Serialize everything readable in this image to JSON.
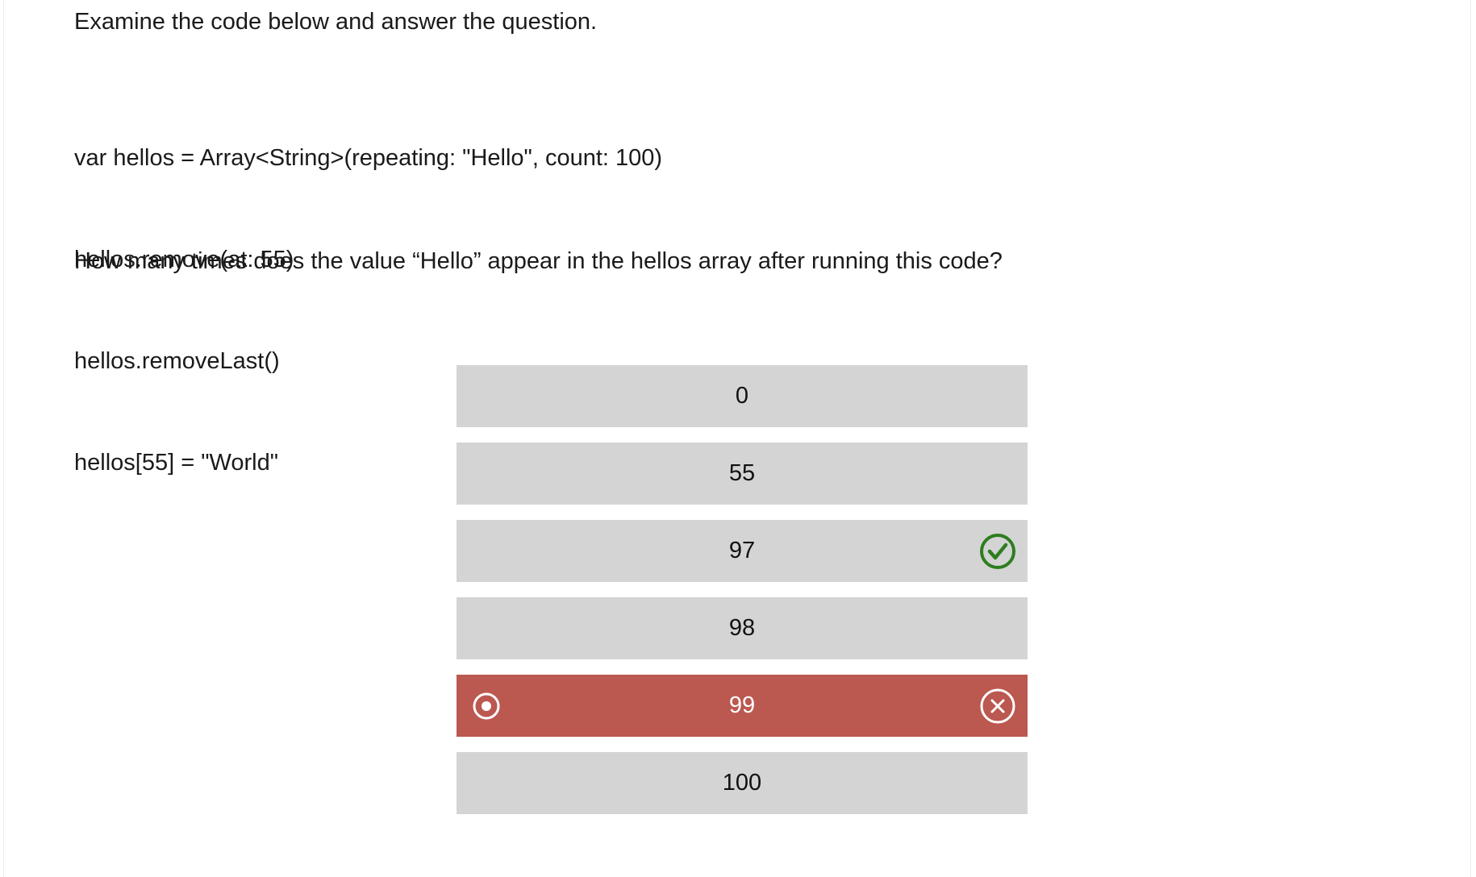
{
  "prompt": "Examine the code below and answer the question.",
  "code_lines": [
    "var hellos = Array<String>(repeating: \"Hello\", count: 100)",
    "hellos.remove(at: 55)",
    "hellos.removeLast()",
    "hellos[55] = \"World\""
  ],
  "question": "How many times does the value “Hello” appear in the hellos array after running this code?",
  "options": [
    {
      "label": "0",
      "state": "default"
    },
    {
      "label": "55",
      "state": "default"
    },
    {
      "label": "97",
      "state": "correct"
    },
    {
      "label": "98",
      "state": "default"
    },
    {
      "label": "99",
      "state": "selected-wrong"
    },
    {
      "label": "100",
      "state": "default"
    }
  ],
  "colors": {
    "option_bg": "#d4d4d4",
    "wrong_bg": "#bb5850",
    "correct_icon": "#2e7d1f",
    "text": "#1a1a1a"
  },
  "icons": {
    "correct": "check-circle-icon",
    "wrong": "x-circle-icon",
    "selected": "radio-selected-icon"
  }
}
